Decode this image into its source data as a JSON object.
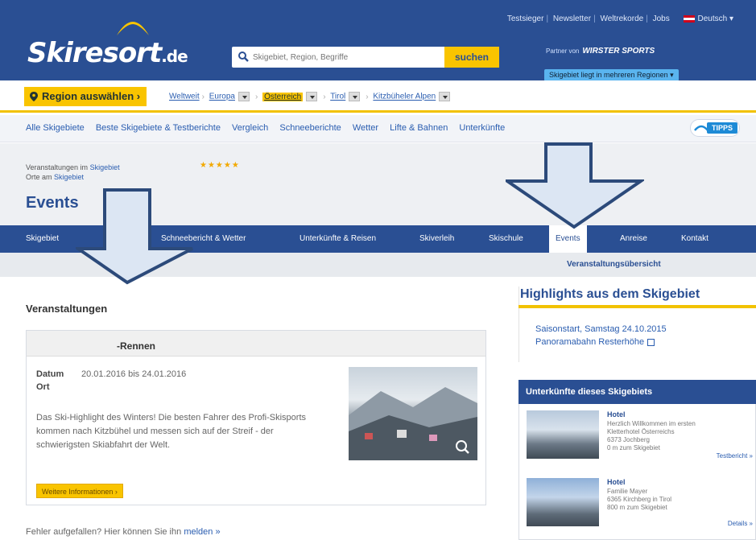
{
  "header": {
    "logo_text": "Skiresort",
    "logo_suffix": ".de",
    "top_links": [
      "Testsieger",
      "Newsletter",
      "Weltrekorde",
      "Jobs"
    ],
    "language": "Deutsch",
    "search_placeholder": "Skigebiet, Region, Begriffe",
    "search_button": "suchen",
    "partner_label": "Partner von",
    "partner_brand": "WIRSTER SPORTS",
    "skigebiet_info": "Skigebiet liegt in mehreren Regionen"
  },
  "regionbar": {
    "button": "Region auswählen",
    "crumbs": [
      "Weltweit",
      "Europa",
      "Österreich",
      "Tirol",
      "Kitzbüheler Alpen"
    ]
  },
  "mainnav": {
    "items": [
      "Alle Skigebiete",
      "Beste Skigebiete & Testberichte",
      "Vergleich",
      "Schneeberichte",
      "Wetter",
      "Lifte & Bahnen",
      "Unterkünfte"
    ],
    "tipps": "TIPPS"
  },
  "resort": {
    "veranstaltungen_prefix": "Veranstaltungen im",
    "veranstaltungen_link": "Skigebiet",
    "orte_prefix": "Orte am",
    "orte_link": "Skigebiet",
    "rating": "★★★★★",
    "page_title": "Events"
  },
  "resortnav": {
    "items": [
      "Skigebiet",
      "Schneebericht & Wetter",
      "Unterkünfte & Reisen",
      "Skiverleih",
      "Skischule",
      "Events",
      "Anreise",
      "Kontakt"
    ],
    "subnav": "Veranstaltungsübersicht"
  },
  "content": {
    "title": "Veranstaltungen",
    "event": {
      "name": "-Rennen",
      "datum_label": "Datum",
      "datum_value": "20.01.2016 bis 24.01.2016",
      "ort_label": "Ort",
      "description": "Das Ski-Highlight des Winters! Die besten Fahrer des Profi-Skisports kommen nach Kitzbühel und messen sich auf der Streif - der schwierigsten Skiabfahrt der Welt.",
      "more_button": "Weitere Informationen ›"
    },
    "fehler_text": "Fehler aufgefallen? Hier können Sie ihn",
    "fehler_link": "melden »"
  },
  "sidebar": {
    "highlights_title": "Highlights aus dem Skigebiet",
    "highlights": [
      "Saisonstart, Samstag 24.10.2015",
      "Panoramabahn Resterhöhe"
    ],
    "unterkuenfte_title": "Unterkünfte dieses Skigebiets",
    "items": [
      {
        "type": "Hotel",
        "lines": [
          "Herzlich Willkommen im ersten",
          "Kletterhotel Österreichs",
          "6373 Jochberg",
          "0 m zum Skigebiet"
        ],
        "link": "Testbericht »"
      },
      {
        "type": "Hotel",
        "lines": [
          "Familie Mayer",
          "6365 Kirchberg in Tirol",
          "800 m zum Skigebiet"
        ],
        "link": "Details »"
      }
    ]
  },
  "colors": {
    "brand_blue": "#2a4f93",
    "accent_yellow": "#f9c400",
    "link_blue": "#2a5db0"
  }
}
